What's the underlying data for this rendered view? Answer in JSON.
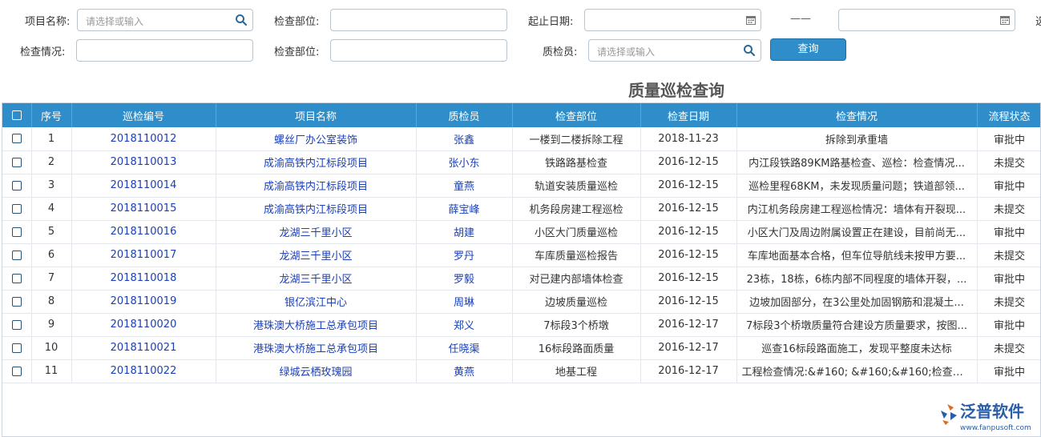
{
  "filters": {
    "project_name_label": "项目名称:",
    "project_name_placeholder": "请选择或输入",
    "inspect_part_label_1": "检查部位:",
    "date_range_label": "起止日期:",
    "date_separator": "——",
    "inspect_status_label": "检查情况:",
    "inspect_part_label_2": "检查部位:",
    "inspector_label": "质检员:",
    "inspector_placeholder": "请选择或输入",
    "query_button": "查询",
    "cut_label": "选"
  },
  "page_title": "质量巡检查询",
  "table": {
    "headers": [
      "序号",
      "巡检编号",
      "项目名称",
      "质检员",
      "检查部位",
      "检查日期",
      "检查情况",
      "流程状态"
    ],
    "rows": [
      {
        "no": "1",
        "code": "2018110012",
        "project": "螺丝厂办公室装饰",
        "inspector": "张鑫",
        "part": "一楼到二楼拆除工程",
        "date": "2018-11-23",
        "status_text": "拆除到承重墙",
        "flow": "审批中"
      },
      {
        "no": "2",
        "code": "2018110013",
        "project": "成渝高铁内江标段项目",
        "inspector": "张小东",
        "part": "铁路路基检查",
        "date": "2016-12-15",
        "status_text": "内江段铁路89KM路基检查、巡检：检查情况...",
        "flow": "未提交"
      },
      {
        "no": "3",
        "code": "2018110014",
        "project": "成渝高铁内江标段项目",
        "inspector": "童燕",
        "part": "轨道安装质量巡检",
        "date": "2016-12-15",
        "status_text": "巡检里程68KM，未发现质量问题；铁道部领...",
        "flow": "审批中"
      },
      {
        "no": "4",
        "code": "2018110015",
        "project": "成渝高铁内江标段项目",
        "inspector": "薛宝峰",
        "part": "机务段房建工程巡检",
        "date": "2016-12-15",
        "status_text": "内江机务段房建工程巡检情况：墙体有开裂现...",
        "flow": "未提交"
      },
      {
        "no": "5",
        "code": "2018110016",
        "project": "龙湖三千里小区",
        "inspector": "胡建",
        "part": "小区大门质量巡检",
        "date": "2016-12-15",
        "status_text": "小区大门及周边附属设置正在建设，目前尚无...",
        "flow": "审批中"
      },
      {
        "no": "6",
        "code": "2018110017",
        "project": "龙湖三千里小区",
        "inspector": "罗丹",
        "part": "车库质量巡检报告",
        "date": "2016-12-15",
        "status_text": "车库地面基本合格，但车位导航线未按甲方要...",
        "flow": "未提交"
      },
      {
        "no": "7",
        "code": "2018110018",
        "project": "龙湖三千里小区",
        "inspector": "罗毅",
        "part": "对已建内部墙体检查",
        "date": "2016-12-15",
        "status_text": "23栋，18栋，6栋内部不同程度的墙体开裂，...",
        "flow": "审批中"
      },
      {
        "no": "8",
        "code": "2018110019",
        "project": "银亿滨江中心",
        "inspector": "周琳",
        "part": "边坡质量巡检",
        "date": "2016-12-15",
        "status_text": "边坡加固部分，在3公里处加固钢筋和混凝土...",
        "flow": "未提交"
      },
      {
        "no": "9",
        "code": "2018110020",
        "project": "港珠澳大桥施工总承包项目",
        "inspector": "郑义",
        "part": "7标段3个桥墩",
        "date": "2016-12-17",
        "status_text": "7标段3个桥墩质量符合建设方质量要求，按图...",
        "flow": "审批中"
      },
      {
        "no": "10",
        "code": "2018110021",
        "project": "港珠澳大桥施工总承包项目",
        "inspector": "任晓渠",
        "part": "16标段路面质量",
        "date": "2016-12-17",
        "status_text": "巡查16标段路面施工，发现平整度未达标",
        "flow": "未提交"
      },
      {
        "no": "11",
        "code": "2018110022",
        "project": "绿城云栖玫瑰园",
        "inspector": "黄燕",
        "part": "地基工程",
        "date": "2016-12-17",
        "status_text": "工程检查情况:&#160; &#160;&#160;检查过程...",
        "flow": "审批中"
      }
    ]
  },
  "logo": {
    "brand_text": "泛普软件",
    "url_text": "www.fanpusoft.com"
  },
  "colors": {
    "header_blue": "#2f8ec9",
    "link_blue": "#1a3fb7"
  }
}
